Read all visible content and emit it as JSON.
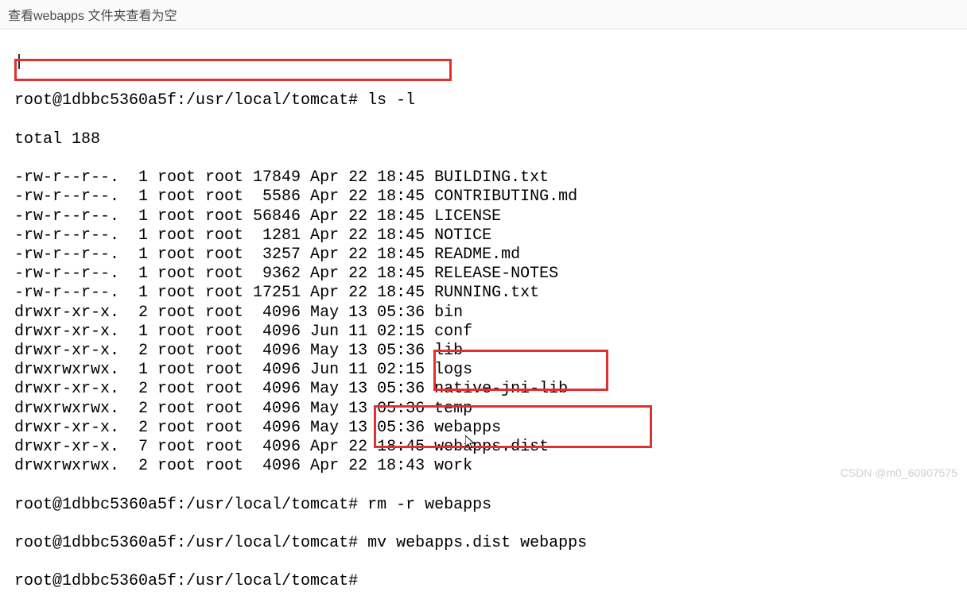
{
  "header": {
    "title": "查看webapps 文件夹查看为空"
  },
  "terminal": {
    "prompt": "root@1dbbc5360a5f:/usr/local/tomcat#",
    "cmd1": "ls -l",
    "total_line": "total 188",
    "listing": [
      {
        "perm": "-rw-r--r--.",
        "links": "1",
        "owner": "root",
        "group": "root",
        "size": "17849",
        "date": "Apr 22 18:45",
        "name": "BUILDING.txt"
      },
      {
        "perm": "-rw-r--r--.",
        "links": "1",
        "owner": "root",
        "group": "root",
        "size": " 5586",
        "date": "Apr 22 18:45",
        "name": "CONTRIBUTING.md"
      },
      {
        "perm": "-rw-r--r--.",
        "links": "1",
        "owner": "root",
        "group": "root",
        "size": "56846",
        "date": "Apr 22 18:45",
        "name": "LICENSE"
      },
      {
        "perm": "-rw-r--r--.",
        "links": "1",
        "owner": "root",
        "group": "root",
        "size": " 1281",
        "date": "Apr 22 18:45",
        "name": "NOTICE"
      },
      {
        "perm": "-rw-r--r--.",
        "links": "1",
        "owner": "root",
        "group": "root",
        "size": " 3257",
        "date": "Apr 22 18:45",
        "name": "README.md"
      },
      {
        "perm": "-rw-r--r--.",
        "links": "1",
        "owner": "root",
        "group": "root",
        "size": " 9362",
        "date": "Apr 22 18:45",
        "name": "RELEASE-NOTES"
      },
      {
        "perm": "-rw-r--r--.",
        "links": "1",
        "owner": "root",
        "group": "root",
        "size": "17251",
        "date": "Apr 22 18:45",
        "name": "RUNNING.txt"
      },
      {
        "perm": "drwxr-xr-x.",
        "links": "2",
        "owner": "root",
        "group": "root",
        "size": " 4096",
        "date": "May 13 05:36",
        "name": "bin"
      },
      {
        "perm": "drwxr-xr-x.",
        "links": "1",
        "owner": "root",
        "group": "root",
        "size": " 4096",
        "date": "Jun 11 02:15",
        "name": "conf"
      },
      {
        "perm": "drwxr-xr-x.",
        "links": "2",
        "owner": "root",
        "group": "root",
        "size": " 4096",
        "date": "May 13 05:36",
        "name": "lib"
      },
      {
        "perm": "drwxrwxrwx.",
        "links": "1",
        "owner": "root",
        "group": "root",
        "size": " 4096",
        "date": "Jun 11 02:15",
        "name": "logs"
      },
      {
        "perm": "drwxr-xr-x.",
        "links": "2",
        "owner": "root",
        "group": "root",
        "size": " 4096",
        "date": "May 13 05:36",
        "name": "native-jni-lib"
      },
      {
        "perm": "drwxrwxrwx.",
        "links": "2",
        "owner": "root",
        "group": "root",
        "size": " 4096",
        "date": "May 13 05:36",
        "name": "temp"
      },
      {
        "perm": "drwxr-xr-x.",
        "links": "2",
        "owner": "root",
        "group": "root",
        "size": " 4096",
        "date": "May 13 05:36",
        "name": "webapps"
      },
      {
        "perm": "drwxr-xr-x.",
        "links": "7",
        "owner": "root",
        "group": "root",
        "size": " 4096",
        "date": "Apr 22 18:45",
        "name": "webapps.dist"
      },
      {
        "perm": "drwxrwxrwx.",
        "links": "2",
        "owner": "root",
        "group": "root",
        "size": " 4096",
        "date": "Apr 22 18:43",
        "name": "work"
      }
    ],
    "cmd2": "rm -r webapps",
    "cmd3": "mv webapps.dist webapps"
  },
  "watermark": "CSDN @m0_60907575"
}
